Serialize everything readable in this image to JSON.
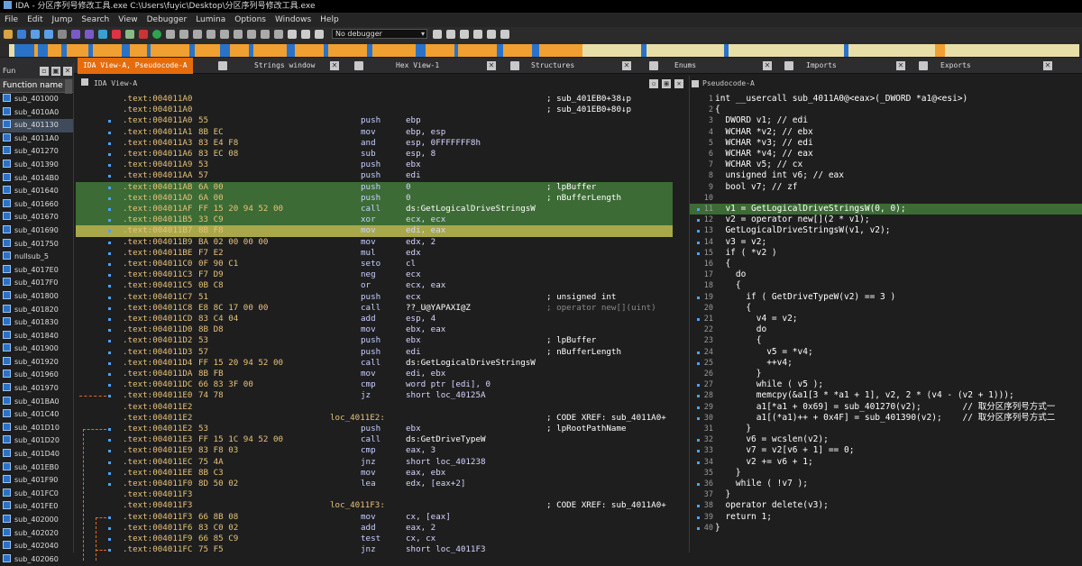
{
  "title": "IDA - 分区序列号修改工具.exe C:\\Users\\fuyic\\Desktop\\分区序列号修改工具.exe",
  "menu": [
    "File",
    "Edit",
    "Jump",
    "Search",
    "View",
    "Debugger",
    "Lumina",
    "Options",
    "Windows",
    "Help"
  ],
  "toolbar": {
    "debugger_select": "No debugger"
  },
  "tabs": [
    "IDA View-A, Pseudocode-A",
    "Strings window",
    "Hex View-1",
    "Structures",
    "Enums",
    "Imports",
    "Exports"
  ],
  "functions_panel": {
    "title": "Fun",
    "column": "Function name",
    "items": [
      "sub_401000",
      "sub_4010A0",
      "sub_401130",
      "sub_4011A0",
      "sub_401270",
      "sub_401390",
      "sub_4014B0",
      "sub_401640",
      "sub_401660",
      "sub_401670",
      "sub_401690",
      "sub_401750",
      "nullsub_5",
      "sub_4017E0",
      "sub_4017F0",
      "sub_401800",
      "sub_401820",
      "sub_401830",
      "sub_401840",
      "sub_401900",
      "sub_401920",
      "sub_401960",
      "sub_401970",
      "sub_401BA0",
      "sub_401C40",
      "sub_401D10",
      "sub_401D20",
      "sub_401D40",
      "sub_401EB0",
      "sub_401F90",
      "sub_401FC0",
      "sub_401FE0",
      "sub_402000",
      "sub_402020",
      "sub_402040",
      "sub_402060"
    ],
    "selected_index": 2
  },
  "ida_view": {
    "title": "IDA View-A",
    "lines": [
      {
        "dot": false,
        "addr": ".text:004011A0",
        "bytes": "",
        "mn": "",
        "op": "",
        "label": "",
        "cm": "; sub_401EB0+38↓p",
        "hl": ""
      },
      {
        "dot": false,
        "addr": ".text:004011A0",
        "bytes": "",
        "mn": "",
        "op": "",
        "label": "",
        "cm": "; sub_401EB0+80↓p",
        "hl": ""
      },
      {
        "dot": true,
        "addr": ".text:004011A0",
        "bytes": "55",
        "mn": "push",
        "op": "ebp",
        "label": "",
        "cm": "",
        "hl": ""
      },
      {
        "dot": true,
        "addr": ".text:004011A1",
        "bytes": "8B EC",
        "mn": "mov",
        "op": "ebp, esp",
        "label": "",
        "cm": "",
        "hl": ""
      },
      {
        "dot": true,
        "addr": ".text:004011A3",
        "bytes": "83 E4 F8",
        "mn": "and",
        "op": "esp, 0FFFFFFF8h",
        "label": "",
        "cm": "",
        "hl": ""
      },
      {
        "dot": true,
        "addr": ".text:004011A6",
        "bytes": "83 EC 08",
        "mn": "sub",
        "op": "esp, 8",
        "label": "",
        "cm": "",
        "hl": ""
      },
      {
        "dot": true,
        "addr": ".text:004011A9",
        "bytes": "53",
        "mn": "push",
        "op": "ebx",
        "label": "",
        "cm": "",
        "hl": ""
      },
      {
        "dot": true,
        "addr": ".text:004011AA",
        "bytes": "57",
        "mn": "push",
        "op": "edi",
        "label": "",
        "cm": "",
        "hl": ""
      },
      {
        "dot": true,
        "addr": ".text:004011AB",
        "bytes": "6A 00",
        "mn": "push",
        "op": "0",
        "label": "",
        "cm": "; lpBuffer",
        "hl": "g"
      },
      {
        "dot": true,
        "addr": ".text:004011AD",
        "bytes": "6A 00",
        "mn": "push",
        "op": "0",
        "label": "",
        "cm": "; nBufferLength",
        "hl": "g"
      },
      {
        "dot": true,
        "addr": ".text:004011AF",
        "bytes": "FF 15 20 94 52 00",
        "mn": "call",
        "op": "ds:GetLogicalDriveStringsW",
        "label": "",
        "cm": "",
        "hl": "g"
      },
      {
        "dot": true,
        "addr": ".text:004011B5",
        "bytes": "33 C9",
        "mn": "xor",
        "op": "ecx, ecx",
        "label": "",
        "cm": "",
        "hl": "g"
      },
      {
        "dot": true,
        "addr": ".text:004011B7",
        "bytes": "8B F8",
        "mn": "mov",
        "op": "edi, eax",
        "label": "",
        "cm": "",
        "hl": "s"
      },
      {
        "dot": true,
        "addr": ".text:004011B9",
        "bytes": "BA 02 00 00 00",
        "mn": "mov",
        "op": "edx, 2",
        "label": "",
        "cm": "",
        "hl": ""
      },
      {
        "dot": true,
        "addr": ".text:004011BE",
        "bytes": "F7 E2",
        "mn": "mul",
        "op": "edx",
        "label": "",
        "cm": "",
        "hl": ""
      },
      {
        "dot": true,
        "addr": ".text:004011C0",
        "bytes": "0F 90 C1",
        "mn": "seto",
        "op": "cl",
        "label": "",
        "cm": "",
        "hl": ""
      },
      {
        "dot": true,
        "addr": ".text:004011C3",
        "bytes": "F7 D9",
        "mn": "neg",
        "op": "ecx",
        "label": "",
        "cm": "",
        "hl": ""
      },
      {
        "dot": true,
        "addr": ".text:004011C5",
        "bytes": "0B C8",
        "mn": "or",
        "op": "ecx, eax",
        "label": "",
        "cm": "",
        "hl": ""
      },
      {
        "dot": true,
        "addr": ".text:004011C7",
        "bytes": "51",
        "mn": "push",
        "op": "ecx",
        "label": "",
        "cm": "; unsigned int",
        "hl": ""
      },
      {
        "dot": true,
        "addr": ".text:004011C8",
        "bytes": "E8 8C 17 00 00",
        "mn": "call",
        "op": "??_U@YAPAXI@Z",
        "label": "",
        "cm": "; operator new[](uint)",
        "hl": "",
        "gray": true
      },
      {
        "dot": true,
        "addr": ".text:004011CD",
        "bytes": "83 C4 04",
        "mn": "add",
        "op": "esp, 4",
        "label": "",
        "cm": "",
        "hl": ""
      },
      {
        "dot": true,
        "addr": ".text:004011D0",
        "bytes": "8B D8",
        "mn": "mov",
        "op": "ebx, eax",
        "label": "",
        "cm": "",
        "hl": ""
      },
      {
        "dot": true,
        "addr": ".text:004011D2",
        "bytes": "53",
        "mn": "push",
        "op": "ebx",
        "label": "",
        "cm": "; lpBuffer",
        "hl": ""
      },
      {
        "dot": true,
        "addr": ".text:004011D3",
        "bytes": "57",
        "mn": "push",
        "op": "edi",
        "label": "",
        "cm": "; nBufferLength",
        "hl": ""
      },
      {
        "dot": true,
        "addr": ".text:004011D4",
        "bytes": "FF 15 20 94 52 00",
        "mn": "call",
        "op": "ds:GetLogicalDriveStringsW",
        "label": "",
        "cm": "",
        "hl": ""
      },
      {
        "dot": true,
        "addr": ".text:004011DA",
        "bytes": "8B FB",
        "mn": "mov",
        "op": "edi, ebx",
        "label": "",
        "cm": "",
        "hl": ""
      },
      {
        "dot": true,
        "addr": ".text:004011DC",
        "bytes": "66 83 3F 00",
        "mn": "cmp",
        "op": "word ptr [edi], 0",
        "label": "",
        "cm": "",
        "hl": ""
      },
      {
        "dot": true,
        "addr": ".text:004011E0",
        "bytes": "74 78",
        "mn": "jz",
        "op": "short loc_40125A",
        "label": "",
        "cm": "",
        "hl": ""
      },
      {
        "dot": false,
        "addr": ".text:004011E2",
        "bytes": "",
        "mn": "",
        "op": "",
        "label": "",
        "cm": "",
        "hl": ""
      },
      {
        "dot": false,
        "addr": ".text:004011E2",
        "bytes": "",
        "mn": "",
        "op": "",
        "label": "loc_4011E2:",
        "cm": "; CODE XREF: sub_4011A0+",
        "hl": ""
      },
      {
        "dot": true,
        "addr": ".text:004011E2",
        "bytes": "53",
        "mn": "push",
        "op": "ebx",
        "label": "",
        "cm": "; lpRootPathName",
        "hl": ""
      },
      {
        "dot": true,
        "addr": ".text:004011E3",
        "bytes": "FF 15 1C 94 52 00",
        "mn": "call",
        "op": "ds:GetDriveTypeW",
        "label": "",
        "cm": "",
        "hl": ""
      },
      {
        "dot": true,
        "addr": ".text:004011E9",
        "bytes": "83 F8 03",
        "mn": "cmp",
        "op": "eax, 3",
        "label": "",
        "cm": "",
        "hl": ""
      },
      {
        "dot": true,
        "addr": ".text:004011EC",
        "bytes": "75 4A",
        "mn": "jnz",
        "op": "short loc_401238",
        "label": "",
        "cm": "",
        "hl": ""
      },
      {
        "dot": true,
        "addr": ".text:004011EE",
        "bytes": "8B C3",
        "mn": "mov",
        "op": "eax, ebx",
        "label": "",
        "cm": "",
        "hl": ""
      },
      {
        "dot": true,
        "addr": ".text:004011F0",
        "bytes": "8D 50 02",
        "mn": "lea",
        "op": "edx, [eax+2]",
        "label": "",
        "cm": "",
        "hl": ""
      },
      {
        "dot": false,
        "addr": ".text:004011F3",
        "bytes": "",
        "mn": "",
        "op": "",
        "label": "",
        "cm": "",
        "hl": ""
      },
      {
        "dot": false,
        "addr": ".text:004011F3",
        "bytes": "",
        "mn": "",
        "op": "",
        "label": "loc_4011F3:",
        "cm": "; CODE XREF: sub_4011A0+",
        "hl": ""
      },
      {
        "dot": true,
        "addr": ".text:004011F3",
        "bytes": "66 8B 08",
        "mn": "mov",
        "op": "cx, [eax]",
        "label": "",
        "cm": "",
        "hl": ""
      },
      {
        "dot": true,
        "addr": ".text:004011F6",
        "bytes": "83 C0 02",
        "mn": "add",
        "op": "eax, 2",
        "label": "",
        "cm": "",
        "hl": ""
      },
      {
        "dot": true,
        "addr": ".text:004011F9",
        "bytes": "66 85 C9",
        "mn": "test",
        "op": "cx, cx",
        "label": "",
        "cm": "",
        "hl": ""
      },
      {
        "dot": true,
        "addr": ".text:004011FC",
        "bytes": "75 F5",
        "mn": "jnz",
        "op": "short loc_4011F3",
        "label": "",
        "cm": "",
        "hl": ""
      }
    ]
  },
  "pseudocode": {
    "title": "Pseudocode-A",
    "lines": [
      {
        "n": "1",
        "dot": false,
        "code": "int __usercall sub_4011A0@<eax>(_DWORD *a1@<esi>)",
        "hl": false
      },
      {
        "n": "2",
        "dot": false,
        "code": "{",
        "hl": false
      },
      {
        "n": "3",
        "dot": false,
        "code": "  DWORD v1; // edi",
        "hl": false
      },
      {
        "n": "4",
        "dot": false,
        "code": "  WCHAR *v2; // ebx",
        "hl": false
      },
      {
        "n": "5",
        "dot": false,
        "code": "  WCHAR *v3; // edi",
        "hl": false
      },
      {
        "n": "6",
        "dot": false,
        "code": "  WCHAR *v4; // eax",
        "hl": false
      },
      {
        "n": "7",
        "dot": false,
        "code": "  WCHAR v5; // cx",
        "hl": false
      },
      {
        "n": "8",
        "dot": false,
        "code": "  unsigned int v6; // eax",
        "hl": false
      },
      {
        "n": "9",
        "dot": false,
        "code": "  bool v7; // zf",
        "hl": false
      },
      {
        "n": "10",
        "dot": false,
        "code": "",
        "hl": false
      },
      {
        "n": "11",
        "dot": true,
        "code": "  v1 = GetLogicalDriveStringsW(0, 0);",
        "hl": true
      },
      {
        "n": "12",
        "dot": true,
        "code": "  v2 = operator new[](2 * v1);",
        "hl": false
      },
      {
        "n": "13",
        "dot": true,
        "code": "  GetLogicalDriveStringsW(v1, v2);",
        "hl": false
      },
      {
        "n": "14",
        "dot": true,
        "code": "  v3 = v2;",
        "hl": false
      },
      {
        "n": "15",
        "dot": true,
        "code": "  if ( *v2 )",
        "hl": false
      },
      {
        "n": "16",
        "dot": false,
        "code": "  {",
        "hl": false
      },
      {
        "n": "17",
        "dot": false,
        "code": "    do",
        "hl": false
      },
      {
        "n": "18",
        "dot": false,
        "code": "    {",
        "hl": false
      },
      {
        "n": "19",
        "dot": true,
        "code": "      if ( GetDriveTypeW(v2) == 3 )",
        "hl": false
      },
      {
        "n": "20",
        "dot": false,
        "code": "      {",
        "hl": false
      },
      {
        "n": "21",
        "dot": true,
        "code": "        v4 = v2;",
        "hl": false
      },
      {
        "n": "22",
        "dot": false,
        "code": "        do",
        "hl": false
      },
      {
        "n": "23",
        "dot": false,
        "code": "        {",
        "hl": false
      },
      {
        "n": "24",
        "dot": true,
        "code": "          v5 = *v4;",
        "hl": false
      },
      {
        "n": "25",
        "dot": true,
        "code": "          ++v4;",
        "hl": false
      },
      {
        "n": "26",
        "dot": false,
        "code": "        }",
        "hl": false
      },
      {
        "n": "27",
        "dot": true,
        "code": "        while ( v5 );",
        "hl": false
      },
      {
        "n": "28",
        "dot": true,
        "code": "        memcpy(&a1[3 * *a1 + 1], v2, 2 * (v4 - (v2 + 1)));",
        "hl": false
      },
      {
        "n": "29",
        "dot": true,
        "code": "        a1[*a1 + 0x69] = sub_401270(v2);        // 取分区序列号方式一",
        "hl": false
      },
      {
        "n": "30",
        "dot": true,
        "code": "        a1[(*a1)++ + 0x4F] = sub_401390(v2);    // 取分区序列号方式二",
        "hl": false
      },
      {
        "n": "31",
        "dot": false,
        "code": "      }",
        "hl": false
      },
      {
        "n": "32",
        "dot": true,
        "code": "      v6 = wcslen(v2);",
        "hl": false
      },
      {
        "n": "33",
        "dot": true,
        "code": "      v7 = v2[v6 + 1] == 0;",
        "hl": false
      },
      {
        "n": "34",
        "dot": true,
        "code": "      v2 += v6 + 1;",
        "hl": false
      },
      {
        "n": "35",
        "dot": false,
        "code": "    }",
        "hl": false
      },
      {
        "n": "36",
        "dot": true,
        "code": "    while ( !v7 );",
        "hl": false
      },
      {
        "n": "37",
        "dot": false,
        "code": "  }",
        "hl": false
      },
      {
        "n": "38",
        "dot": true,
        "code": "  operator delete(v3);",
        "hl": false
      },
      {
        "n": "39",
        "dot": true,
        "code": "  return 1;",
        "hl": false
      },
      {
        "n": "40",
        "dot": true,
        "code": "}",
        "hl": false
      }
    ]
  },
  "colors": {
    "accent": "#e56c0c",
    "highlight": "#3c6b35",
    "selection": "#a8a84a",
    "navblue": "#2a72c8",
    "navorange": "#f0a030",
    "navcream": "#e8dfa8"
  }
}
